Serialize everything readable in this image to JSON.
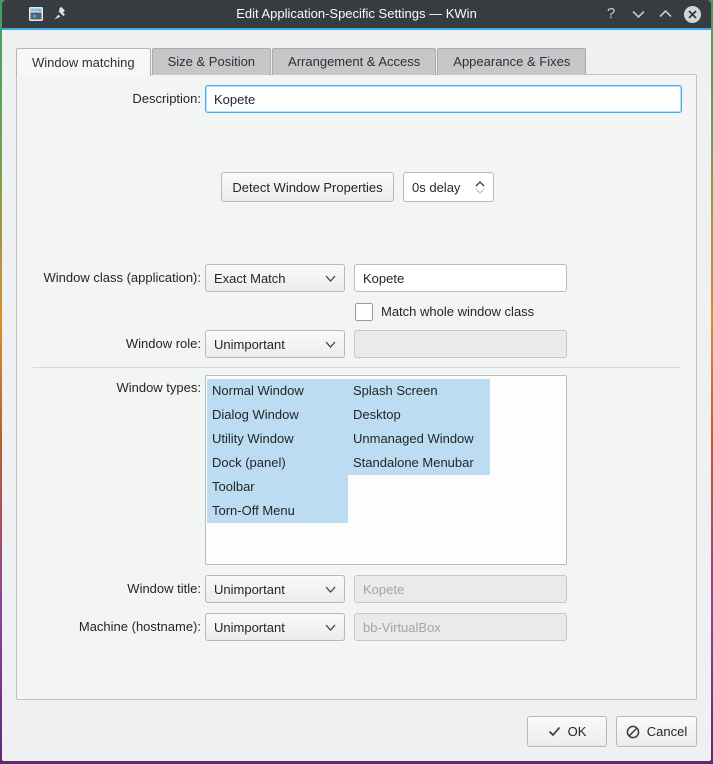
{
  "colors": {
    "accent": "#3daee9",
    "titlebar_bg": "#373c41",
    "selection": "#bcdcf1"
  },
  "titlebar": {
    "title": "Edit Application-Specific Settings — KWin"
  },
  "tabs": [
    {
      "label": "Window matching"
    },
    {
      "label": "Size & Position"
    },
    {
      "label": "Arrangement & Access"
    },
    {
      "label": "Appearance & Fixes"
    }
  ],
  "form": {
    "description": {
      "label": "Description:",
      "value": "Kopete"
    },
    "detect": {
      "button": "Detect Window Properties",
      "delay": "0s delay"
    },
    "window_class": {
      "label": "Window class (application):",
      "match": "Exact Match",
      "value": "Kopete"
    },
    "match_whole_label": "Match whole window class",
    "window_role": {
      "label": "Window role:",
      "match": "Unimportant",
      "value": ""
    },
    "window_types": {
      "label": "Window types:",
      "items": [
        {
          "label": "Normal Window"
        },
        {
          "label": "Dialog Window"
        },
        {
          "label": "Utility Window"
        },
        {
          "label": "Dock (panel)"
        },
        {
          "label": "Toolbar"
        },
        {
          "label": "Torn-Off Menu"
        },
        {
          "label": "Splash Screen"
        },
        {
          "label": "Desktop"
        },
        {
          "label": "Unmanaged Window"
        },
        {
          "label": "Standalone Menubar"
        }
      ]
    },
    "window_title": {
      "label": "Window title:",
      "match": "Unimportant",
      "value": "Kopete"
    },
    "machine": {
      "label": "Machine (hostname):",
      "match": "Unimportant",
      "value": "bb-VirtualBox"
    }
  },
  "actions": {
    "ok": "OK",
    "cancel": "Cancel"
  }
}
